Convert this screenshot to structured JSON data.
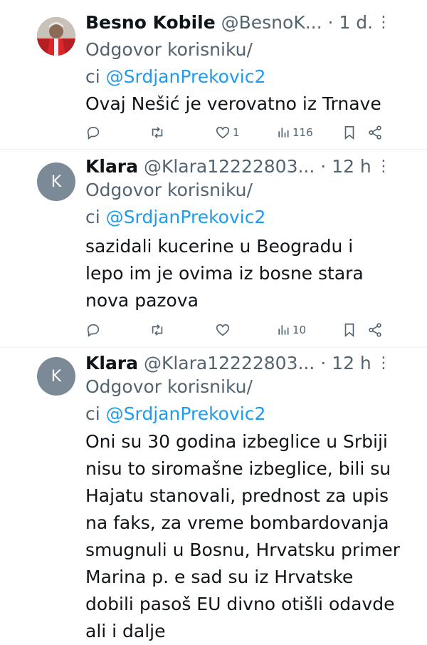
{
  "tweets": [
    {
      "name": "Besno Kobile",
      "handle": "@BesnoK...",
      "time": "· 1 d.",
      "reply_prefix": "Odgovor korisniku/",
      "reply_ci": "ci ",
      "reply_to": "@SrdjanPrekovic2",
      "text": "Ovaj Nešić je verovatno iz Trnave",
      "likes": "1",
      "views": "116",
      "avatar_type": "photo"
    },
    {
      "name": "Klara",
      "handle": "@Klara12222803...",
      "time": "· 12 h",
      "reply_prefix": "Odgovor korisniku/",
      "reply_ci": "ci ",
      "reply_to": "@SrdjanPrekovic2",
      "text": "sazidali kucerine u Beogradu i lepo im je ovima iz bosne stara nova pazova",
      "likes": "",
      "views": "10",
      "avatar_letter": "K"
    },
    {
      "name": "Klara",
      "handle": "@Klara12222803...",
      "time": "· 12 h",
      "reply_prefix": "Odgovor korisniku/",
      "reply_ci": "ci ",
      "reply_to": "@SrdjanPrekovic2",
      "text": "Oni su 30 godina izbeglice u Srbiji nisu to siromašne izbeglice, bili su Hajatu stanovali, prednost za upis na faks, za vreme bombardovanja smugnuli u Bosnu, Hrvatsku primer Marina p. e sad su iz Hrvatske dobili pasoš EU divno otišli odavde ali i dalje",
      "avatar_letter": "K"
    }
  ],
  "more_glyph": "⋮",
  "colors": {
    "link": "#1d9bf0",
    "secondary": "#536471",
    "text": "#0f1419"
  },
  "icons": [
    "reply-icon",
    "retweet-icon",
    "like-icon",
    "views-icon",
    "bookmark-icon",
    "share-icon"
  ]
}
